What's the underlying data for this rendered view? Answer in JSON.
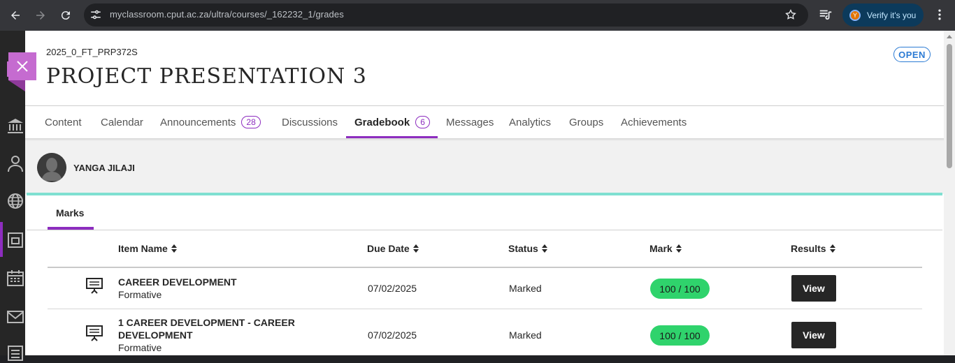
{
  "browser": {
    "url": "myclassroom.cput.ac.za/ultra/courses/_162232_1/grades",
    "profile_initial": "Y",
    "verify_label": "Verify it's you"
  },
  "course": {
    "code": "2025_0_FT_PRP372S",
    "title": "PROJECT PRESENTATION 3",
    "status": "OPEN"
  },
  "tabs": [
    {
      "label": "Content"
    },
    {
      "label": "Calendar"
    },
    {
      "label": "Announcements",
      "count": "28"
    },
    {
      "label": "Discussions"
    },
    {
      "label": "Gradebook",
      "count": "6"
    },
    {
      "label": "Messages"
    },
    {
      "label": "Analytics"
    },
    {
      "label": "Groups"
    },
    {
      "label": "Achievements"
    }
  ],
  "active_tab": "Gradebook",
  "student": {
    "name": "YANGA JILAJI"
  },
  "subtab": {
    "label": "Marks"
  },
  "table": {
    "columns": [
      "Item Name",
      "Due Date",
      "Status",
      "Mark",
      "Results"
    ],
    "rows": [
      {
        "name": "CAREER DEVELOPMENT",
        "type": "Formative",
        "due": "07/02/2025",
        "status": "Marked",
        "mark": "100 / 100",
        "action": "View"
      },
      {
        "name": "1 CAREER DEVELOPMENT - CAREER DEVELOPMENT",
        "type": "Formative",
        "due": "07/02/2025",
        "status": "Marked",
        "mark": "100 / 100",
        "action": "View"
      }
    ]
  },
  "colors": {
    "accent": "#8d2dbf",
    "open_badge": "#2c7bd4",
    "mark_pill": "#2fd36c",
    "teal_line": "#7fe0d1"
  }
}
